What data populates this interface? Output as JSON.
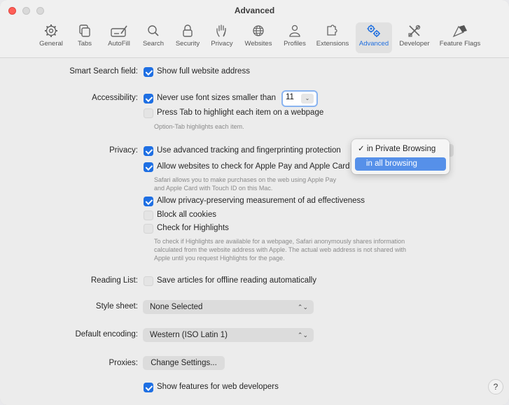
{
  "window": {
    "title": "Advanced"
  },
  "toolbar": {
    "tabs": [
      {
        "label": "General",
        "icon": "gear-icon"
      },
      {
        "label": "Tabs",
        "icon": "tabs-icon"
      },
      {
        "label": "AutoFill",
        "icon": "autofill-icon"
      },
      {
        "label": "Search",
        "icon": "search-icon"
      },
      {
        "label": "Security",
        "icon": "lock-icon"
      },
      {
        "label": "Privacy",
        "icon": "hand-icon"
      },
      {
        "label": "Websites",
        "icon": "globe-icon"
      },
      {
        "label": "Profiles",
        "icon": "person-icon"
      },
      {
        "label": "Extensions",
        "icon": "puzzle-icon"
      },
      {
        "label": "Advanced",
        "icon": "gears-icon"
      },
      {
        "label": "Developer",
        "icon": "tools-icon"
      },
      {
        "label": "Feature Flags",
        "icon": "flags-icon"
      }
    ],
    "active_tab": "Advanced",
    "accent_color": "#1f6fe0"
  },
  "smart_search": {
    "label": "Smart Search field:",
    "option": "Show full website address",
    "checked": true
  },
  "accessibility": {
    "label": "Accessibility:",
    "min_font_option": "Never use font sizes smaller than",
    "min_font_checked": true,
    "min_font_value": "11",
    "tab_option": "Press Tab to highlight each item on a webpage",
    "tab_checked": false,
    "tab_note": "Option-Tab highlights each item."
  },
  "privacy": {
    "label": "Privacy:",
    "tracking_option": "Use advanced tracking and fingerprinting protection",
    "tracking_checked": true,
    "tracking_menu": [
      "✓ in Private Browsing",
      "in all browsing"
    ],
    "tracking_menu_highlighted": "in all browsing",
    "applepay_option": "Allow websites to check for Apple Pay and Apple Card",
    "applepay_checked": true,
    "applepay_note_1": "Safari allows you to make purchases on the web using Apple Pay",
    "applepay_note_2": "and Apple Card with Touch ID on this Mac.",
    "measurement_option": "Allow privacy-preserving measurement of ad effectiveness",
    "measurement_checked": true,
    "cookies_option": "Block all cookies",
    "cookies_checked": false,
    "highlights_option": "Check for Highlights",
    "highlights_checked": false,
    "highlights_note_1": "To check if Highlights are available for a webpage, Safari anonymously shares information",
    "highlights_note_2": "calculated from the website address with Apple. The actual web address is not shared with",
    "highlights_note_3": "Apple until you request Highlights for the page."
  },
  "reading_list": {
    "label": "Reading List:",
    "option": "Save articles for offline reading automatically",
    "checked": false
  },
  "style_sheet": {
    "label": "Style sheet:",
    "value": "None Selected"
  },
  "encoding": {
    "label": "Default encoding:",
    "value": "Western (ISO Latin 1)"
  },
  "proxies": {
    "label": "Proxies:",
    "button": "Change Settings..."
  },
  "developer": {
    "option": "Show features for web developers",
    "checked": true
  },
  "help": {
    "label": "?"
  }
}
